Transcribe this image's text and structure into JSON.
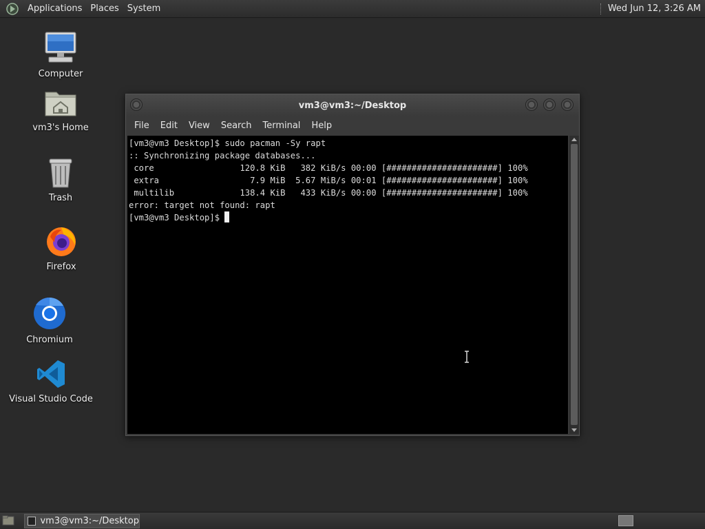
{
  "top_panel": {
    "menus": [
      "Applications",
      "Places",
      "System"
    ],
    "clock": "Wed Jun 12,  3:26 AM"
  },
  "desktop_icons": [
    {
      "label": "Computer",
      "icon": "computer-icon"
    },
    {
      "label": "vm3's Home",
      "icon": "home-folder-icon"
    },
    {
      "label": "Trash",
      "icon": "trash-icon"
    },
    {
      "label": "Firefox",
      "icon": "firefox-icon"
    },
    {
      "label": "Chromium",
      "icon": "chromium-icon"
    },
    {
      "label": "Visual Studio Code",
      "icon": "vscode-icon"
    }
  ],
  "terminal": {
    "title": "vm3@vm3:~/Desktop",
    "menus": [
      "File",
      "Edit",
      "View",
      "Search",
      "Terminal",
      "Help"
    ],
    "lines": [
      "[vm3@vm3 Desktop]$ sudo pacman -Sy rapt",
      ":: Synchronizing package databases...",
      " core                 120.8 KiB   382 KiB/s 00:00 [######################] 100%",
      " extra                  7.9 MiB  5.67 MiB/s 00:01 [######################] 100%",
      " multilib             138.4 KiB   433 KiB/s 00:00 [######################] 100%",
      "error: target not found: rapt"
    ],
    "prompt": "[vm3@vm3 Desktop]$ "
  },
  "bottom_panel": {
    "task_label": "vm3@vm3:~/Desktop"
  }
}
